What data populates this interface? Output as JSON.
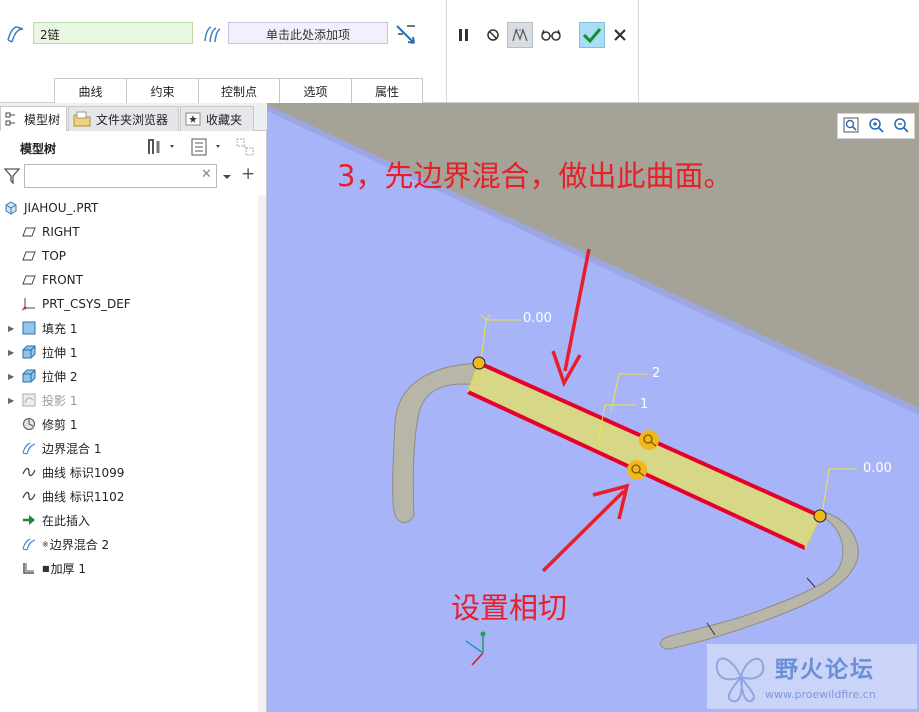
{
  "dashboard": {
    "chain_field": "2链",
    "ref_field": "单击此处添加项",
    "tabs": [
      {
        "label": "曲线"
      },
      {
        "label": "约束"
      },
      {
        "label": "控制点"
      },
      {
        "label": "选项"
      },
      {
        "label": "属性"
      }
    ],
    "tools": {
      "pause": "pause-icon",
      "no_preview": "no-preview-icon",
      "preview": "preview-icon",
      "glasses": "glasses-icon",
      "ok": "checkmark-icon",
      "cancel": "close-icon"
    }
  },
  "panel": {
    "tabs": [
      {
        "label": "模型树"
      },
      {
        "label": "文件夹浏览器"
      },
      {
        "label": "收藏夹"
      }
    ],
    "title": "模型树",
    "filter_placeholder": "",
    "tree": [
      {
        "label": "JIAHOU_.PRT",
        "icon": "part-icon",
        "expandable": false,
        "indent": 0
      },
      {
        "label": "RIGHT",
        "icon": "datum-plane-icon",
        "expandable": false,
        "indent": 1
      },
      {
        "label": "TOP",
        "icon": "datum-plane-icon",
        "expandable": false,
        "indent": 1
      },
      {
        "label": "FRONT",
        "icon": "datum-plane-icon",
        "expandable": false,
        "indent": 1
      },
      {
        "label": "PRT_CSYS_DEF",
        "icon": "csys-icon",
        "expandable": false,
        "indent": 1
      },
      {
        "label": "填充 1",
        "icon": "fill-icon",
        "expandable": true,
        "indent": 1
      },
      {
        "label": "拉伸 1",
        "icon": "extrude-icon",
        "expandable": true,
        "indent": 1
      },
      {
        "label": "拉伸 2",
        "icon": "extrude-icon",
        "expandable": true,
        "indent": 1
      },
      {
        "label": "投影 1",
        "icon": "project-icon",
        "expandable": true,
        "indent": 1,
        "dim": true
      },
      {
        "label": "修剪 1",
        "icon": "trim-icon",
        "expandable": false,
        "indent": 1
      },
      {
        "label": "边界混合 1",
        "icon": "boundary-blend-icon",
        "expandable": false,
        "indent": 1
      },
      {
        "label": "曲线 标识1099",
        "icon": "curve-icon",
        "expandable": false,
        "indent": 1
      },
      {
        "label": "曲线 标识1102",
        "icon": "curve-icon",
        "expandable": false,
        "indent": 1
      },
      {
        "label": "在此插入",
        "icon": "insert-arrow-icon",
        "expandable": false,
        "indent": 1
      },
      {
        "label": "边界混合 2",
        "icon": "boundary-blend-icon",
        "expandable": false,
        "indent": 1,
        "marker": "※"
      },
      {
        "label": "加厚 1",
        "icon": "thicken-icon",
        "expandable": false,
        "indent": 1,
        "marker": "■"
      }
    ]
  },
  "viewport": {
    "annotation_title": "3，先边界混合，做出此曲面。",
    "annotation_tangent": "设置相切",
    "dim_labels": [
      "0.00",
      "2",
      "1",
      "0.00"
    ],
    "watermark_name": "野火论坛",
    "watermark_url": "www.proewildfire.cn",
    "colors": {
      "background_blue": "#a7b4f7",
      "background_gray": "#a5a397",
      "surface_yellow": "#dcdc7a",
      "highlight_red": "#e8002c",
      "annotation_red": "#e81e2a"
    }
  }
}
